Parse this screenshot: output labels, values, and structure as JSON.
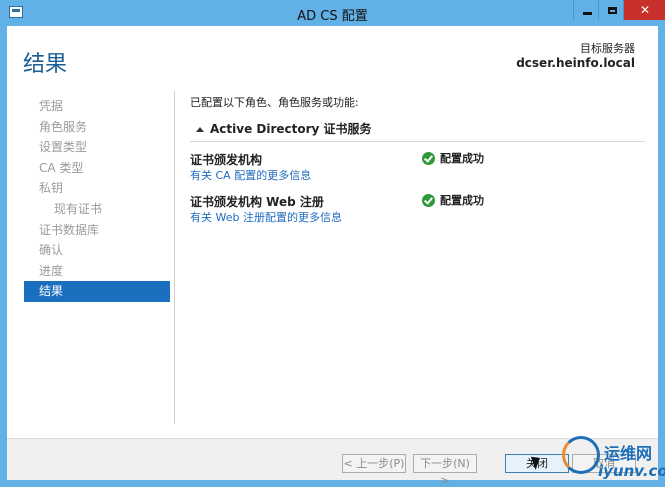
{
  "window": {
    "title": "AD CS 配置",
    "controls": {
      "minimize": "minimize-icon",
      "maximize": "maximize-icon",
      "close": "✕"
    }
  },
  "header": {
    "title": "结果",
    "target_label": "目标服务器",
    "target_server": "dcser.heinfo.local"
  },
  "sidebar": {
    "items": [
      {
        "label": "凭据",
        "active": false,
        "sub": false
      },
      {
        "label": "角色服务",
        "active": false,
        "sub": false
      },
      {
        "label": "设置类型",
        "active": false,
        "sub": false
      },
      {
        "label": "CA 类型",
        "active": false,
        "sub": false
      },
      {
        "label": "私钥",
        "active": false,
        "sub": false
      },
      {
        "label": "现有证书",
        "active": false,
        "sub": true
      },
      {
        "label": "证书数据库",
        "active": false,
        "sub": false
      },
      {
        "label": "确认",
        "active": false,
        "sub": false
      },
      {
        "label": "进度",
        "active": false,
        "sub": false
      },
      {
        "label": "结果",
        "active": true,
        "sub": false
      }
    ]
  },
  "main": {
    "intro": "已配置以下角色、角色服务或功能:",
    "section_title": "Active Directory 证书服务",
    "results": [
      {
        "name": "证书颁发机构",
        "link": "有关 CA 配置的更多信息",
        "status": "配置成功"
      },
      {
        "name": "证书颁发机构 Web 注册",
        "link": "有关 Web 注册配置的更多信息",
        "status": "配置成功"
      }
    ]
  },
  "footer": {
    "prev_label": "< 上一步(P)",
    "next_label": "下一步(N) >",
    "close_label": "关闭",
    "cancel_label": "取消"
  },
  "watermark": {
    "brand": "运维网",
    "site": "iyunv.com"
  },
  "colors": {
    "accent": "#1b6fbf",
    "titlebar": "#62b1e6",
    "success": "#2e9a39",
    "link": "#1f6cc0"
  }
}
